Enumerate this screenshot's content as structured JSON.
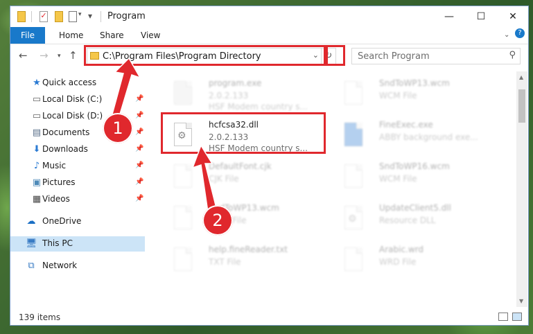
{
  "window": {
    "title": "Program",
    "controls": {
      "minimize": "—",
      "maximize": "☐",
      "close": "✕"
    }
  },
  "ribbon": {
    "tabs": [
      "File",
      "Home",
      "Share",
      "View"
    ]
  },
  "address": {
    "path": "C:\\Program Files\\Program Directory",
    "search_placeholder": "Search Program"
  },
  "sidebar": {
    "items": [
      {
        "label": "Quick access",
        "icon": "star-icon",
        "pinned": false
      },
      {
        "label": "Local Disk (C:)",
        "icon": "drive-icon",
        "pinned": true
      },
      {
        "label": "Local Disk (D:)",
        "icon": "drive-icon",
        "pinned": true
      },
      {
        "label": "Documents",
        "icon": "documents-icon",
        "pinned": true
      },
      {
        "label": "Downloads",
        "icon": "downloads-icon",
        "pinned": true
      },
      {
        "label": "Music",
        "icon": "music-icon",
        "pinned": true
      },
      {
        "label": "Pictures",
        "icon": "pictures-icon",
        "pinned": true
      },
      {
        "label": "Videos",
        "icon": "videos-icon",
        "pinned": true
      },
      {
        "label": "OneDrive",
        "icon": "cloud-icon",
        "pinned": false
      },
      {
        "label": "This PC",
        "icon": "pc-icon",
        "pinned": false,
        "selected": true
      },
      {
        "label": "Network",
        "icon": "network-icon",
        "pinned": false
      }
    ]
  },
  "files": {
    "left": [
      {
        "name": "program.exe",
        "line2": "2.0.2.133",
        "line3": "HSF Modem country s...",
        "faded": true
      },
      {
        "name": "hcfcsa32.dll",
        "line2": "2.0.2.133",
        "line3": "HSF Modem country s...",
        "faded": false,
        "highlighted": true
      },
      {
        "name": "DefaultFont.cjk",
        "line2": "CJK File",
        "line3": "",
        "faded": true
      },
      {
        "name": "SndToWP13.wcm",
        "line2": "WCM File",
        "line3": "",
        "faded": true
      },
      {
        "name": "help.fineReader.txt",
        "line2": "TXT File",
        "line3": "",
        "faded": true
      }
    ],
    "right": [
      {
        "name": "SndToWP13.wcm",
        "line2": "WCM File",
        "line3": "",
        "faded": true
      },
      {
        "name": "FineExec.exe",
        "line2": "ABBY background exe...",
        "line3": "",
        "faded": true
      },
      {
        "name": "SndToWP16.wcm",
        "line2": "WCM File",
        "line3": "",
        "faded": true
      },
      {
        "name": "UpdateClient5.dll",
        "line2": "Resource DLL",
        "line3": "",
        "faded": true
      },
      {
        "name": "Arabic.wrd",
        "line2": "WRD File",
        "line3": "",
        "faded": true
      }
    ]
  },
  "status": {
    "count": "139 items"
  },
  "steps": {
    "one": "1",
    "two": "2"
  },
  "colors": {
    "accent": "#1979ca",
    "highlight": "#e0282d",
    "selected_nav": "#cce4f7"
  }
}
